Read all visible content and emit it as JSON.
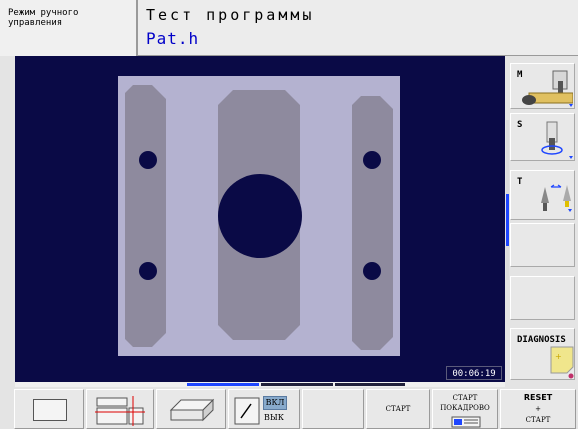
{
  "header": {
    "mode_line1": "Режим ручного",
    "mode_line2": "управления",
    "title": "Тест программы",
    "program_name": "Pat.h"
  },
  "graphics": {
    "clock": "00:06:19",
    "background_color": "#0a0a46",
    "workpiece_color": "#b4b2d0"
  },
  "right_softkeys": [
    {
      "label": "M",
      "icon": "spindle-machine-icon"
    },
    {
      "label": "S",
      "icon": "spindle-speed-icon"
    },
    {
      "label": "T",
      "icon": "tool-icon"
    },
    {
      "label": "",
      "icon": ""
    },
    {
      "label": "",
      "icon": ""
    },
    {
      "label": "DIAGNOSIS",
      "icon": "diagnosis-note-icon"
    },
    {
      "label": "RESET",
      "icon": ""
    }
  ],
  "bottom_softkeys": {
    "toggle_on": "ВКЛ",
    "toggle_off": "ВЫК",
    "start": "СТАРТ",
    "start_block_line1": "СТАРТ",
    "start_block_line2": "ПОКАДРОВО",
    "reset_line1": "RESET",
    "reset_line2": "+",
    "reset_line3": "СТАРТ"
  }
}
